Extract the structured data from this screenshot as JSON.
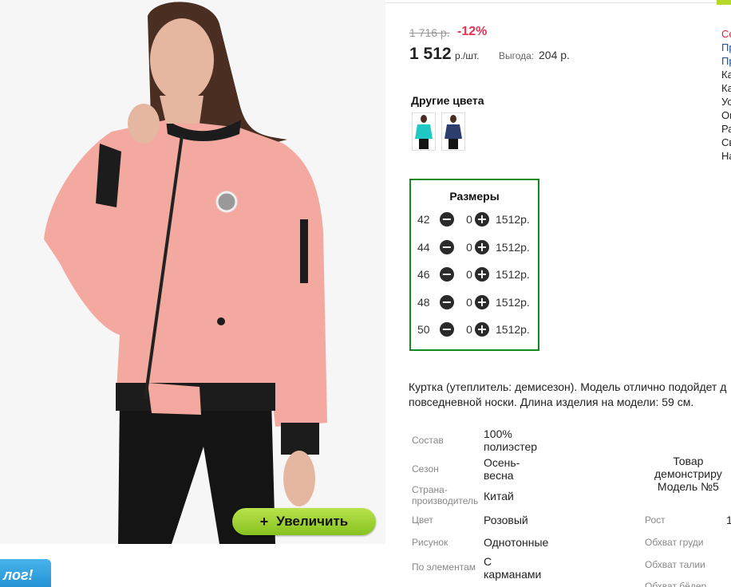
{
  "product": {
    "old_price": "1 716 р.",
    "discount": "-12%",
    "price": "1 512",
    "price_unit": "р./шт.",
    "saving_label": "Выгода:",
    "saving_value": "204 р.",
    "zoom_label": "Увеличить",
    "zoom_icon": "plus-icon",
    "blog_badge": "лог!"
  },
  "right_column": [
    "Со",
    "Пр",
    "Пр",
    "Ка",
    "Ка",
    "Ус",
    "Оп",
    "Ра",
    "Св",
    "На"
  ],
  "other_colors": {
    "title": "Другие цвета",
    "swatches": [
      {
        "color": "#20c8c4"
      },
      {
        "color": "#2c3e6e"
      }
    ]
  },
  "sizes": {
    "title": "Размеры",
    "rows": [
      {
        "size": "42",
        "qty": "0",
        "price": "1512р."
      },
      {
        "size": "44",
        "qty": "0",
        "price": "1512р."
      },
      {
        "size": "46",
        "qty": "0",
        "price": "1512р."
      },
      {
        "size": "48",
        "qty": "0",
        "price": "1512р."
      },
      {
        "size": "50",
        "qty": "0",
        "price": "1512р."
      }
    ]
  },
  "description": {
    "line1": "Куртка (утеплитель: демисезон). Модель отлично подойдет д",
    "line2": "повседневной носки. Длина изделия на модели: 59 см."
  },
  "specs": {
    "composition_label": "Состав",
    "composition_value_1": "100%",
    "composition_value_2": "полиэстер",
    "season_label": "Сезон",
    "season_value_1": "Осень-",
    "season_value_2": "весна",
    "country_label_1": "Страна-",
    "country_label_2": "производитель",
    "country_value": "Китай",
    "color_label": "Цвет",
    "color_value": "Розовый",
    "pattern_label": "Рисунок",
    "pattern_value": "Однотонные",
    "elements_label": "По элементам",
    "elements_value_1": "С",
    "elements_value_2": "карманами"
  },
  "model": {
    "note_1": "Товар",
    "note_2": "демонстриру",
    "note_3": "Модель №5",
    "height_label": "Рост",
    "height_value": "1",
    "chest_label": "Обхват груди",
    "waist_label": "Обхват талии",
    "hips_label": "Обхват бёдер"
  }
}
